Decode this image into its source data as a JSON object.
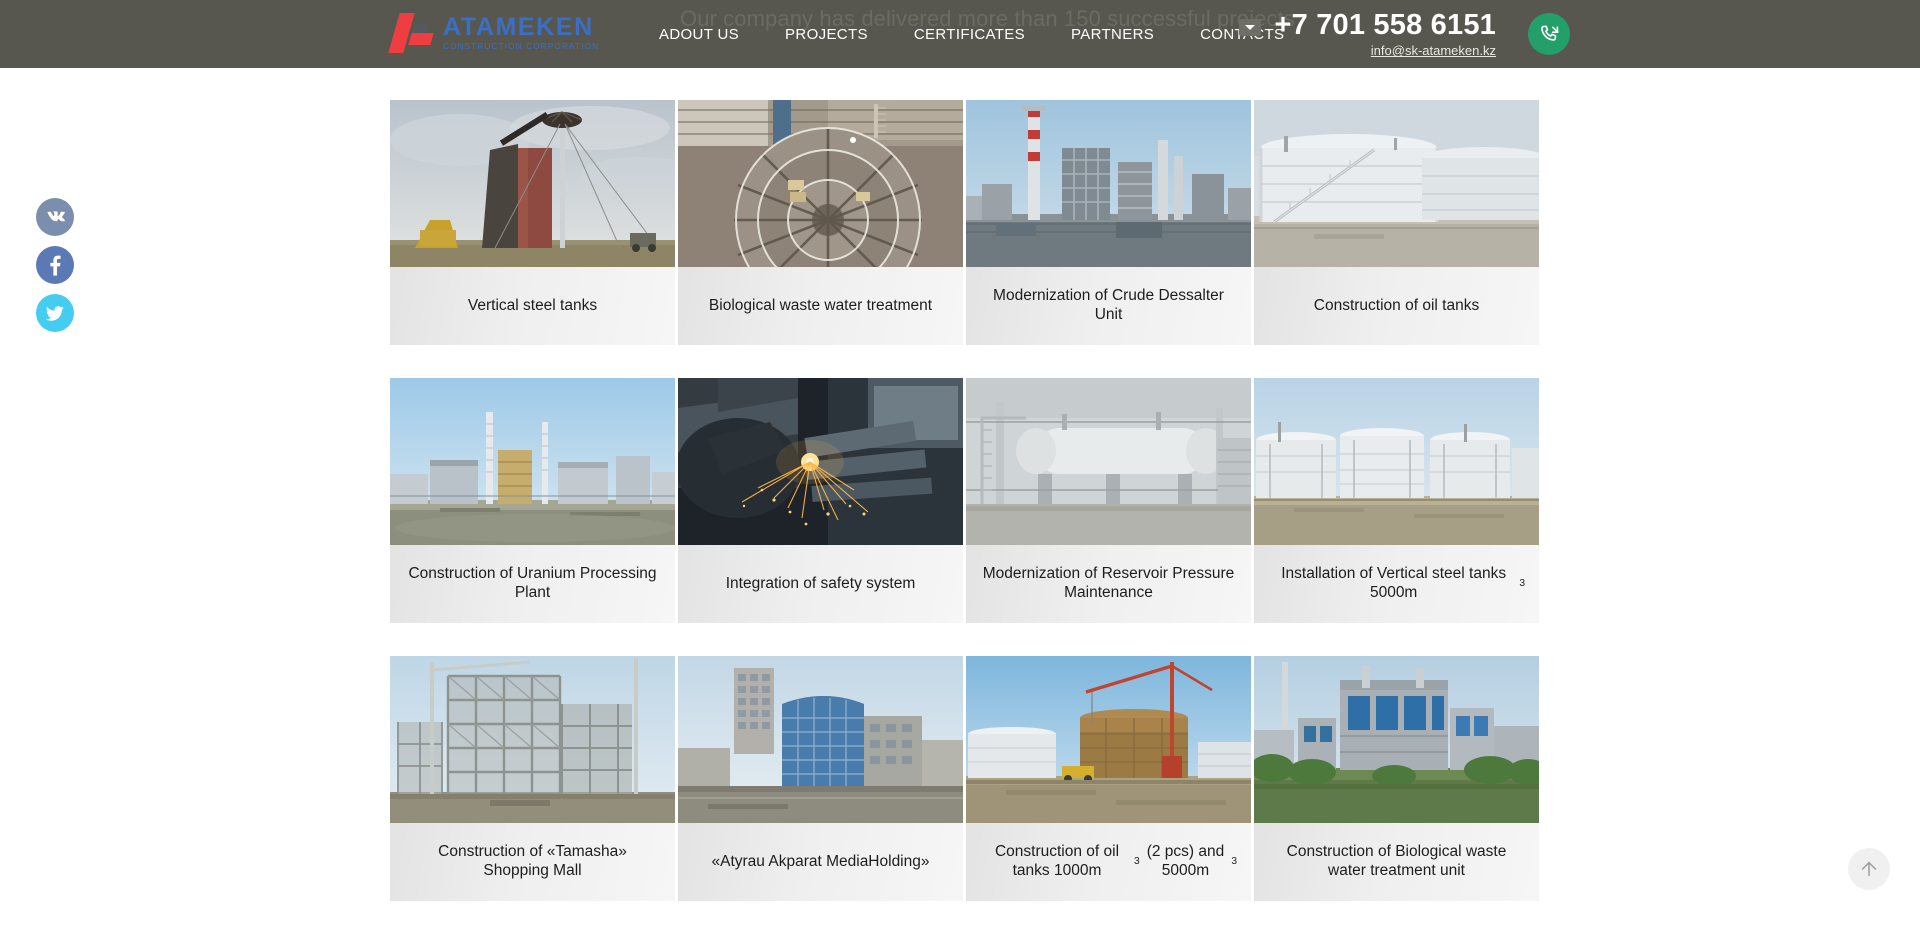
{
  "header": {
    "bg_text": "Our company has delivered more than 150 successful projects",
    "logo_name": "ATAMEKEN",
    "logo_sub": "CONSTRUCTION CORPORATION",
    "nav": [
      {
        "label": "ADOUT US"
      },
      {
        "label": "PROJECTS"
      },
      {
        "label": "CERTIFICATES"
      },
      {
        "label": "PARTNERS"
      },
      {
        "label": "CONTACTS"
      }
    ],
    "phone": "+7 701 558 6151",
    "email": "info@sk-atameken.kz",
    "lang_icon": "chevron-down-icon",
    "callback_icon": "phone-incoming-icon",
    "bar_color": "#57574f",
    "accent_red": "#ef3e42",
    "accent_blue": "#3a6fc4",
    "callback_green": "#23a06a"
  },
  "social": [
    {
      "name": "vk",
      "label": "VK",
      "color": "#7b8ead"
    },
    {
      "name": "facebook",
      "label": "f",
      "color": "#5b7ab5"
    },
    {
      "name": "twitter",
      "label": "twitter-bird",
      "color": "#44cdf0"
    }
  ],
  "projects": {
    "rows": [
      [
        {
          "title": "Vertical steel tanks",
          "image": "steel-tank-erection"
        },
        {
          "title": "Biological waste water treatment",
          "image": "circular-basin-construction"
        },
        {
          "title": "Modernization of Crude Dessalter Unit",
          "image": "refinery-towers"
        },
        {
          "title": "Construction of oil tanks",
          "image": "white-storage-tanks"
        }
      ],
      [
        {
          "title": "Construction of Uranium Processing Plant",
          "image": "uranium-plant"
        },
        {
          "title": "Integration of safety system",
          "image": "welding-sparks"
        },
        {
          "title": "Modernization of Reservoir Pressure Maintenance",
          "image": "pressure-vessels"
        },
        {
          "title": "Installation of Vertical steel tanks 5000m",
          "sup": "3",
          "image": "tank-farm"
        }
      ],
      [
        {
          "title": "Construction of «Tamasha» Shopping Mall",
          "image": "mall-steel-frame"
        },
        {
          "title": "«Atyrau Akparat MediaHolding»",
          "image": "media-building"
        },
        {
          "title": "Construction of oil tanks 1000m",
          "sup": "3",
          "title2": " (2 pcs) and 5000m",
          "sup2": "3",
          "image": "tank-under-construction"
        },
        {
          "title": "Construction of Biological waste water treatment unit",
          "image": "treatment-plant"
        }
      ]
    ]
  },
  "scroll_top": {
    "icon": "arrow-up-icon"
  }
}
